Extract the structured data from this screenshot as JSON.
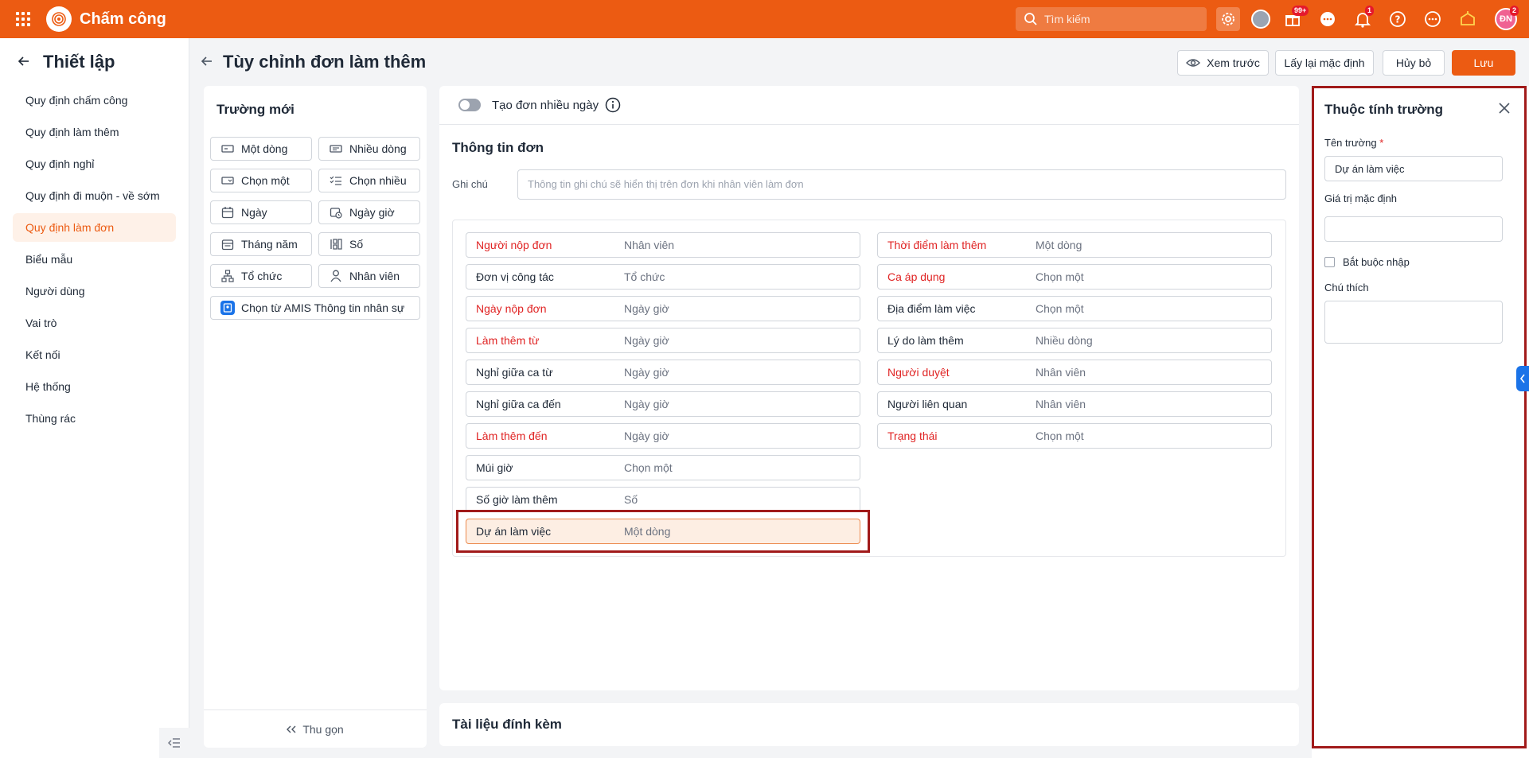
{
  "app": {
    "title": "Chấm công",
    "search_placeholder": "Tìm kiếm",
    "notif_badge": "99+",
    "bell_badge": "1",
    "user_initials": "ĐN",
    "user_badge": "2"
  },
  "sidebar": {
    "title": "Thiết lập",
    "items": [
      {
        "label": "Quy định chấm công"
      },
      {
        "label": "Quy định làm thêm"
      },
      {
        "label": "Quy định nghỉ"
      },
      {
        "label": "Quy định đi muộn - về sớm"
      },
      {
        "label": "Quy định làm đơn",
        "active": true
      },
      {
        "label": "Biểu mẫu"
      },
      {
        "label": "Người dùng"
      },
      {
        "label": "Vai trò"
      },
      {
        "label": "Kết nối"
      },
      {
        "label": "Hệ thống"
      },
      {
        "label": "Thùng rác"
      }
    ]
  },
  "page": {
    "title": "Tùy chỉnh đơn làm thêm",
    "buttons": {
      "preview": "Xem trước",
      "reset": "Lấy lại mặc định",
      "cancel": "Hủy bỏ",
      "save": "Lưu"
    }
  },
  "new_fields": {
    "title": "Trường mới",
    "chips": [
      {
        "label": "Một dòng",
        "icon": "single-line-icon"
      },
      {
        "label": "Nhiều dòng",
        "icon": "multi-line-icon"
      },
      {
        "label": "Chọn một",
        "icon": "dropdown-icon"
      },
      {
        "label": "Chọn nhiều",
        "icon": "checklist-icon"
      },
      {
        "label": "Ngày",
        "icon": "calendar-icon"
      },
      {
        "label": "Ngày giờ",
        "icon": "calendar-clock-icon"
      },
      {
        "label": "Tháng năm",
        "icon": "calendar-month-icon"
      },
      {
        "label": "Số",
        "icon": "number-icon"
      },
      {
        "label": "Tổ chức",
        "icon": "org-icon"
      },
      {
        "label": "Nhân viên",
        "icon": "person-icon"
      },
      {
        "label": "Chọn từ AMIS Thông tin nhân sự",
        "icon": "amis-icon"
      }
    ],
    "collapse_label": "Thu gọn"
  },
  "form": {
    "multi_day_label": "Tạo đơn nhiều ngày",
    "section_title": "Thông tin đơn",
    "note_label": "Ghi chú",
    "note_placeholder": "Thông tin ghi chú sẽ hiển thị trên đơn khi nhân viên làm đơn",
    "left_fields": [
      {
        "name": "Người nộp đơn",
        "type": "Nhân viên",
        "required": true
      },
      {
        "name": "Đơn vị công tác",
        "type": "Tổ chức",
        "required": false
      },
      {
        "name": "Ngày nộp đơn",
        "type": "Ngày giờ",
        "required": true
      },
      {
        "name": "Làm thêm từ",
        "type": "Ngày giờ",
        "required": true
      },
      {
        "name": "Nghỉ giữa ca từ",
        "type": "Ngày giờ",
        "required": false
      },
      {
        "name": "Nghỉ giữa ca đến",
        "type": "Ngày giờ",
        "required": false
      },
      {
        "name": "Làm thêm đến",
        "type": "Ngày giờ",
        "required": true
      },
      {
        "name": "Múi giờ",
        "type": "Chọn một",
        "required": false
      },
      {
        "name": "Số giờ làm thêm",
        "type": "Số",
        "required": false
      },
      {
        "name": "Dự án làm việc",
        "type": "Một dòng",
        "required": false,
        "selected": true
      }
    ],
    "right_fields": [
      {
        "name": "Thời điểm làm thêm",
        "type": "Một dòng",
        "required": true
      },
      {
        "name": "Ca áp dụng",
        "type": "Chọn một",
        "required": true
      },
      {
        "name": "Địa điểm làm việc",
        "type": "Chọn một",
        "required": false
      },
      {
        "name": "Lý do làm thêm",
        "type": "Nhiều dòng",
        "required": false
      },
      {
        "name": "Người duyệt",
        "type": "Nhân viên",
        "required": true
      },
      {
        "name": "Người liên quan",
        "type": "Nhân viên",
        "required": false
      },
      {
        "name": "Trạng thái",
        "type": "Chọn một",
        "required": true
      }
    ],
    "attachments_title": "Tài liệu đính kèm"
  },
  "properties": {
    "title": "Thuộc tính trường",
    "field_name_label": "Tên trường",
    "required_mark": "*",
    "field_name_value": "Dự án làm việc",
    "default_label": "Giá trị mặc định",
    "default_value": "",
    "required_checkbox_label": "Bắt buộc nhập",
    "required_checked": false,
    "note_label": "Chú thích",
    "note_value": ""
  },
  "colors": {
    "brand": "#ec5b12",
    "required": "#e02424",
    "highlight": "#a11a1a"
  }
}
